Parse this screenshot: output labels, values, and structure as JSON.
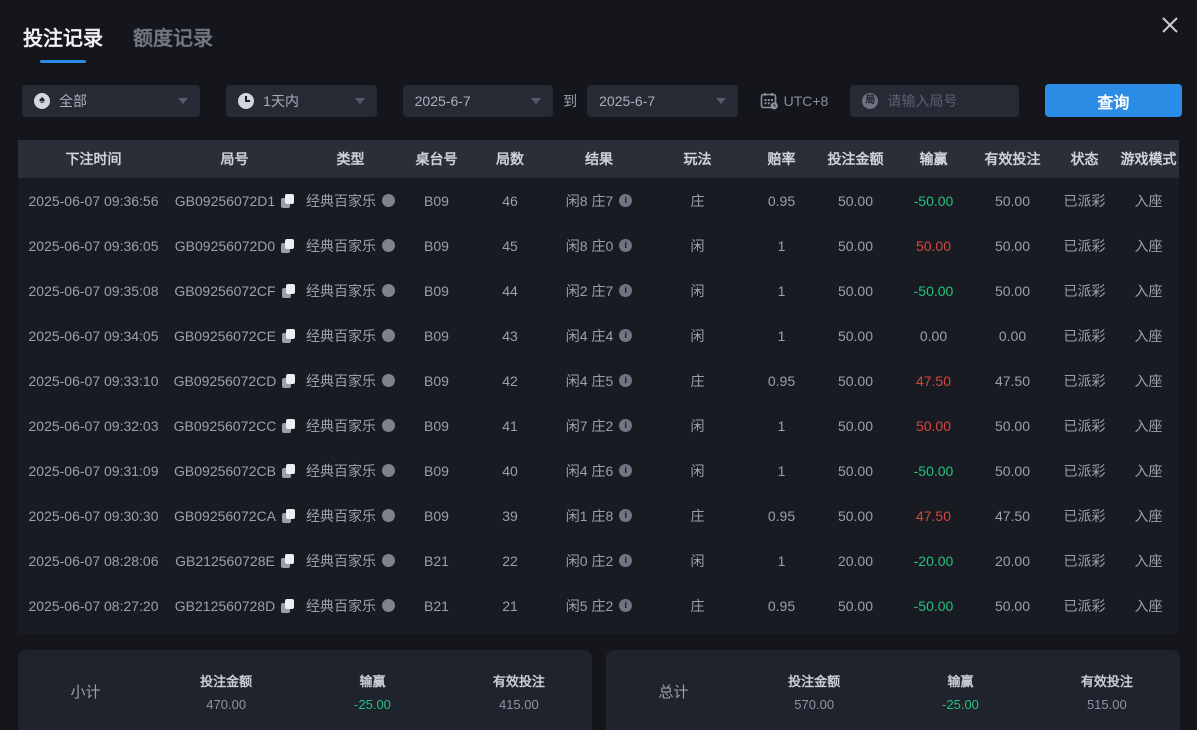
{
  "tabs": [
    {
      "label": "投注记录",
      "active": true
    },
    {
      "label": "额度记录",
      "active": false
    }
  ],
  "filters": {
    "game_type": "全部",
    "time_range": "1天内",
    "date_from": "2025-6-7",
    "to_label": "到",
    "date_to": "2025-6-7",
    "timezone": "UTC+8",
    "round_input_placeholder": "请输入局号",
    "search_button": "查询"
  },
  "icons": {
    "spade_glyph": "♠",
    "round_glyph": "局",
    "info_glyph": "i"
  },
  "table": {
    "columns": [
      "下注时间",
      "局号",
      "类型",
      "桌台号",
      "局数",
      "结果",
      "玩法",
      "赔率",
      "投注金额",
      "输赢",
      "有效投注",
      "状态",
      "游戏模式"
    ],
    "rows": [
      {
        "time": "2025-06-07 09:36:56",
        "round_id": "GB09256072D1",
        "type": "经典百家乐",
        "table_no": "B09",
        "round_no": "46",
        "result": "闲8 庄7",
        "play": "庄",
        "odds": "0.95",
        "bet_amount": "50.00",
        "win_loss": "-50.00",
        "win_loss_color": "green",
        "valid_bet": "50.00",
        "status": "已派彩",
        "mode": "入座"
      },
      {
        "time": "2025-06-07 09:36:05",
        "round_id": "GB09256072D0",
        "type": "经典百家乐",
        "table_no": "B09",
        "round_no": "45",
        "result": "闲8 庄0",
        "play": "闲",
        "odds": "1",
        "bet_amount": "50.00",
        "win_loss": "50.00",
        "win_loss_color": "red",
        "valid_bet": "50.00",
        "status": "已派彩",
        "mode": "入座"
      },
      {
        "time": "2025-06-07 09:35:08",
        "round_id": "GB09256072CF",
        "type": "经典百家乐",
        "table_no": "B09",
        "round_no": "44",
        "result": "闲2 庄7",
        "play": "闲",
        "odds": "1",
        "bet_amount": "50.00",
        "win_loss": "-50.00",
        "win_loss_color": "green",
        "valid_bet": "50.00",
        "status": "已派彩",
        "mode": "入座"
      },
      {
        "time": "2025-06-07 09:34:05",
        "round_id": "GB09256072CE",
        "type": "经典百家乐",
        "table_no": "B09",
        "round_no": "43",
        "result": "闲4 庄4",
        "play": "闲",
        "odds": "1",
        "bet_amount": "50.00",
        "win_loss": "0.00",
        "win_loss_color": "neutral",
        "valid_bet": "0.00",
        "status": "已派彩",
        "mode": "入座"
      },
      {
        "time": "2025-06-07 09:33:10",
        "round_id": "GB09256072CD",
        "type": "经典百家乐",
        "table_no": "B09",
        "round_no": "42",
        "result": "闲4 庄5",
        "play": "庄",
        "odds": "0.95",
        "bet_amount": "50.00",
        "win_loss": "47.50",
        "win_loss_color": "red",
        "valid_bet": "47.50",
        "status": "已派彩",
        "mode": "入座"
      },
      {
        "time": "2025-06-07 09:32:03",
        "round_id": "GB09256072CC",
        "type": "经典百家乐",
        "table_no": "B09",
        "round_no": "41",
        "result": "闲7 庄2",
        "play": "闲",
        "odds": "1",
        "bet_amount": "50.00",
        "win_loss": "50.00",
        "win_loss_color": "red",
        "valid_bet": "50.00",
        "status": "已派彩",
        "mode": "入座"
      },
      {
        "time": "2025-06-07 09:31:09",
        "round_id": "GB09256072CB",
        "type": "经典百家乐",
        "table_no": "B09",
        "round_no": "40",
        "result": "闲4 庄6",
        "play": "闲",
        "odds": "1",
        "bet_amount": "50.00",
        "win_loss": "-50.00",
        "win_loss_color": "green",
        "valid_bet": "50.00",
        "status": "已派彩",
        "mode": "入座"
      },
      {
        "time": "2025-06-07 09:30:30",
        "round_id": "GB09256072CA",
        "type": "经典百家乐",
        "table_no": "B09",
        "round_no": "39",
        "result": "闲1 庄8",
        "play": "庄",
        "odds": "0.95",
        "bet_amount": "50.00",
        "win_loss": "47.50",
        "win_loss_color": "red",
        "valid_bet": "47.50",
        "status": "已派彩",
        "mode": "入座"
      },
      {
        "time": "2025-06-07 08:28:06",
        "round_id": "GB212560728E",
        "type": "经典百家乐",
        "table_no": "B21",
        "round_no": "22",
        "result": "闲0 庄2",
        "play": "闲",
        "odds": "1",
        "bet_amount": "20.00",
        "win_loss": "-20.00",
        "win_loss_color": "green",
        "valid_bet": "20.00",
        "status": "已派彩",
        "mode": "入座"
      },
      {
        "time": "2025-06-07 08:27:20",
        "round_id": "GB212560728D",
        "type": "经典百家乐",
        "table_no": "B21",
        "round_no": "21",
        "result": "闲5 庄2",
        "play": "庄",
        "odds": "0.95",
        "bet_amount": "50.00",
        "win_loss": "-50.00",
        "win_loss_color": "green",
        "valid_bet": "50.00",
        "status": "已派彩",
        "mode": "入座"
      }
    ]
  },
  "summary": {
    "subtotal": {
      "label": "小计",
      "bet_amount_label": "投注金额",
      "bet_amount": "470.00",
      "win_loss_label": "输赢",
      "win_loss": "-25.00",
      "valid_bet_label": "有效投注",
      "valid_bet": "415.00"
    },
    "total": {
      "label": "总计",
      "bet_amount_label": "投注金额",
      "bet_amount": "570.00",
      "win_loss_label": "输赢",
      "win_loss": "-25.00",
      "valid_bet_label": "有效投注",
      "valid_bet": "515.00"
    }
  },
  "colors": {
    "accent_blue": "#2b8ce6",
    "win_red": "#d9453c",
    "loss_green": "#25c17d"
  }
}
